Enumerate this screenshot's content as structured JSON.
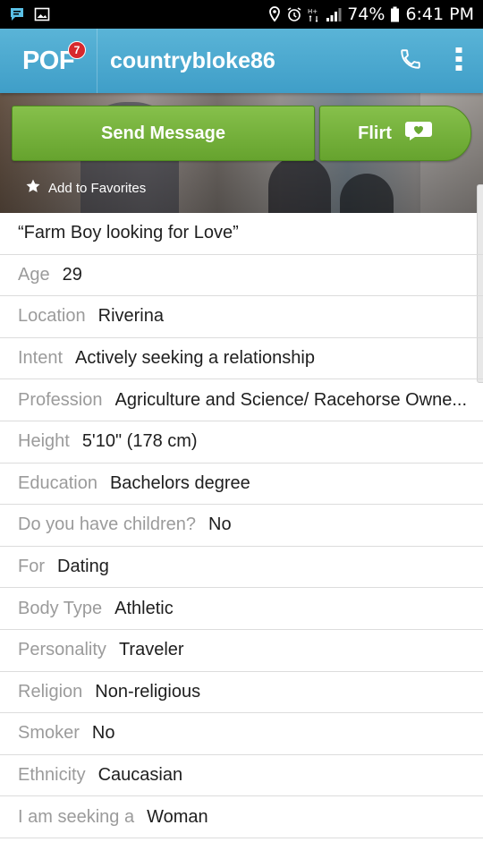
{
  "status_bar": {
    "battery": "74%",
    "time": "6:41 PM",
    "icons": [
      "message-icon",
      "image-icon",
      "location-icon",
      "alarm-icon",
      "network-icon",
      "signal-icon",
      "battery-icon"
    ]
  },
  "header": {
    "logo": "POF",
    "badge": "7",
    "username": "countrybloke86",
    "icons": [
      "phone-icon",
      "more-vert-icon"
    ]
  },
  "actions": {
    "send_message": "Send Message",
    "flirt": "Flirt",
    "add_favorites": "Add to Favorites"
  },
  "profile": {
    "headline": "“Farm Boy looking for Love”",
    "fields": [
      {
        "label": "Age",
        "value": "29"
      },
      {
        "label": "Location",
        "value": "Riverina"
      },
      {
        "label": "Intent",
        "value": "Actively seeking a relationship"
      },
      {
        "label": "Profession",
        "value": "Agriculture and Science/ Racehorse Owne..."
      },
      {
        "label": "Height",
        "value": "5'10\" (178 cm)"
      },
      {
        "label": "Education",
        "value": "Bachelors degree"
      },
      {
        "label": "Do you have children?",
        "value": "No"
      },
      {
        "label": "For",
        "value": "Dating"
      },
      {
        "label": "Body Type",
        "value": "Athletic"
      },
      {
        "label": "Personality",
        "value": "Traveler"
      },
      {
        "label": "Religion",
        "value": "Non-religious"
      },
      {
        "label": "Smoker",
        "value": "No"
      },
      {
        "label": "Ethnicity",
        "value": "Caucasian"
      },
      {
        "label": "I am seeking a",
        "value": "Woman"
      }
    ]
  },
  "colors": {
    "header": "#4aaad2",
    "button": "#76b23c",
    "badge": "#d7282d"
  }
}
